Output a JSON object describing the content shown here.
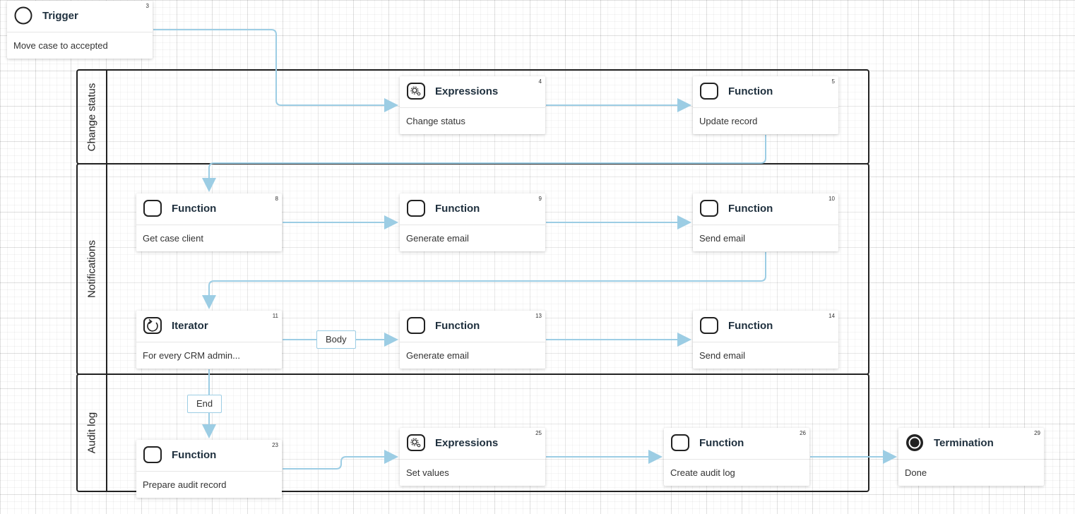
{
  "lanes": [
    {
      "id": "change-status",
      "title": "Change status"
    },
    {
      "id": "notifications",
      "title": "Notifications"
    },
    {
      "id": "audit-log",
      "title": "Audit log"
    }
  ],
  "nodes": {
    "n3": {
      "icon": "trigger-icon",
      "title": "Trigger",
      "number": "3",
      "desc": "Move case to accepted"
    },
    "n4": {
      "icon": "expressions-icon",
      "title": "Expressions",
      "number": "4",
      "desc": "Change status"
    },
    "n5": {
      "icon": "function-icon",
      "title": "Function",
      "number": "5",
      "desc": "Update record"
    },
    "n8": {
      "icon": "function-icon",
      "title": "Function",
      "number": "8",
      "desc": "Get case client"
    },
    "n9": {
      "icon": "function-icon",
      "title": "Function",
      "number": "9",
      "desc": "Generate email"
    },
    "n10": {
      "icon": "function-icon",
      "title": "Function",
      "number": "10",
      "desc": "Send email"
    },
    "n11": {
      "icon": "iterator-icon",
      "title": "Iterator",
      "number": "11",
      "desc": "For every CRM admin..."
    },
    "n13": {
      "icon": "function-icon",
      "title": "Function",
      "number": "13",
      "desc": "Generate email"
    },
    "n14": {
      "icon": "function-icon",
      "title": "Function",
      "number": "14",
      "desc": "Send email"
    },
    "n23": {
      "icon": "function-icon",
      "title": "Function",
      "number": "23",
      "desc": "Prepare audit record"
    },
    "n25": {
      "icon": "expressions-icon",
      "title": "Expressions",
      "number": "25",
      "desc": "Set values"
    },
    "n26": {
      "icon": "function-icon",
      "title": "Function",
      "number": "26",
      "desc": "Create audit log"
    },
    "n29": {
      "icon": "termination-icon",
      "title": "Termination",
      "number": "29",
      "desc": "Done"
    }
  },
  "edge_labels": {
    "body": "Body",
    "end": "End"
  },
  "colors": {
    "edge": "#9ccde4",
    "lane_border": "#222222",
    "node_title": "#1e2f3d"
  }
}
